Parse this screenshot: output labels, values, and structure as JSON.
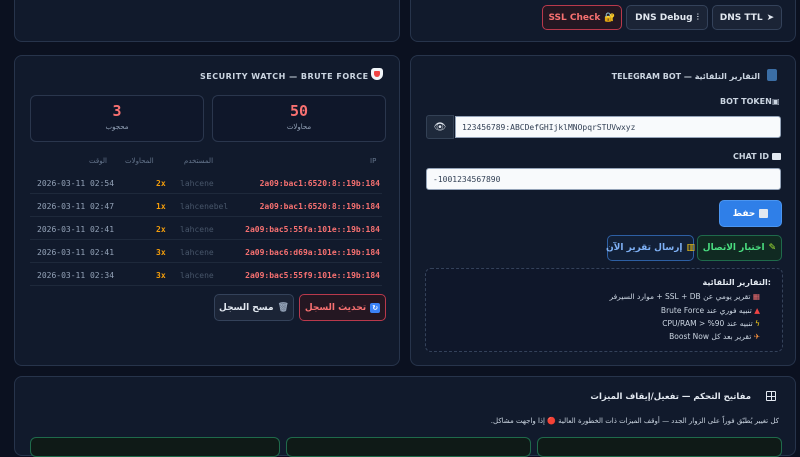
{
  "top_panel": {
    "ssl_check": "SSL Check",
    "dns_debug": "DNS Debug",
    "dns_ttl": "DNS TTL"
  },
  "security": {
    "title": "SECURITY WATCH — BRUTE FORCE",
    "stats": [
      {
        "value": "50",
        "label": "محاولات"
      },
      {
        "value": "3",
        "label": "محجوب"
      }
    ],
    "headers": {
      "ip": "IP",
      "user": "المستخدم",
      "attempts": "المحاولات",
      "time": "الوقت"
    },
    "rows": [
      {
        "ip": "2a09:bac1:6520:8::19b:184",
        "user": "lahcene",
        "count": "2x",
        "time": "2026-03-11 02:54"
      },
      {
        "ip": "2a09:bac1:6520:8::19b:184",
        "user": "lahcenebel",
        "count": "1x",
        "time": "2026-03-11 02:47"
      },
      {
        "ip": "2a09:bac5:55fa:101e::19b:184",
        "user": "lahcene",
        "count": "2x",
        "time": "2026-03-11 02:41"
      },
      {
        "ip": "2a09:bac6:d69a:101e::19b:184",
        "user": "lahcene",
        "count": "3x",
        "time": "2026-03-11 02:41"
      },
      {
        "ip": "2a09:bac5:55f9:101e::19b:184",
        "user": "lahcene",
        "count": "3x",
        "time": "2026-03-11 02:34"
      }
    ],
    "refresh_label": "تحديث السجل",
    "clear_label": "مسح السجل"
  },
  "telegram": {
    "title": "TELEGRAM BOT — التقارير التلقائية",
    "token_label": "BOT TOKEN",
    "token_value": "123456789:ABCDefGHIjklMNOpqrSTUVwxyz",
    "chat_label": "CHAT ID",
    "chat_value": "-1001234567890",
    "save_label": "حفظ",
    "test_label": "اختبار الاتصال",
    "send_label": "إرسال تقرير الآن",
    "info_title": "التقارير التلقائية:",
    "info_lines": [
      "تقرير يومي عن SSL + DB + موارد السيرفر",
      "تنبيه فوري عند Brute Force",
      "تنبيه عند 90% < CPU/RAM",
      "تقرير بعد كل Boost Now"
    ]
  },
  "controls": {
    "title": "مفاتيح التحكم — تفعيل/إيقاف الميزات",
    "description": "كل تغيير يُطبّق فوراً على الزوار الجدد — أوقف الميزات ذات الخطورة العالية 🔴 إذا واجهت مشاكل."
  },
  "colors": {
    "background": "#0b1120",
    "panel": "#111a2c",
    "danger": "#f87171",
    "accent_blue": "#2f7fe8",
    "success": "#4ade80",
    "warning": "#f59e0b"
  }
}
